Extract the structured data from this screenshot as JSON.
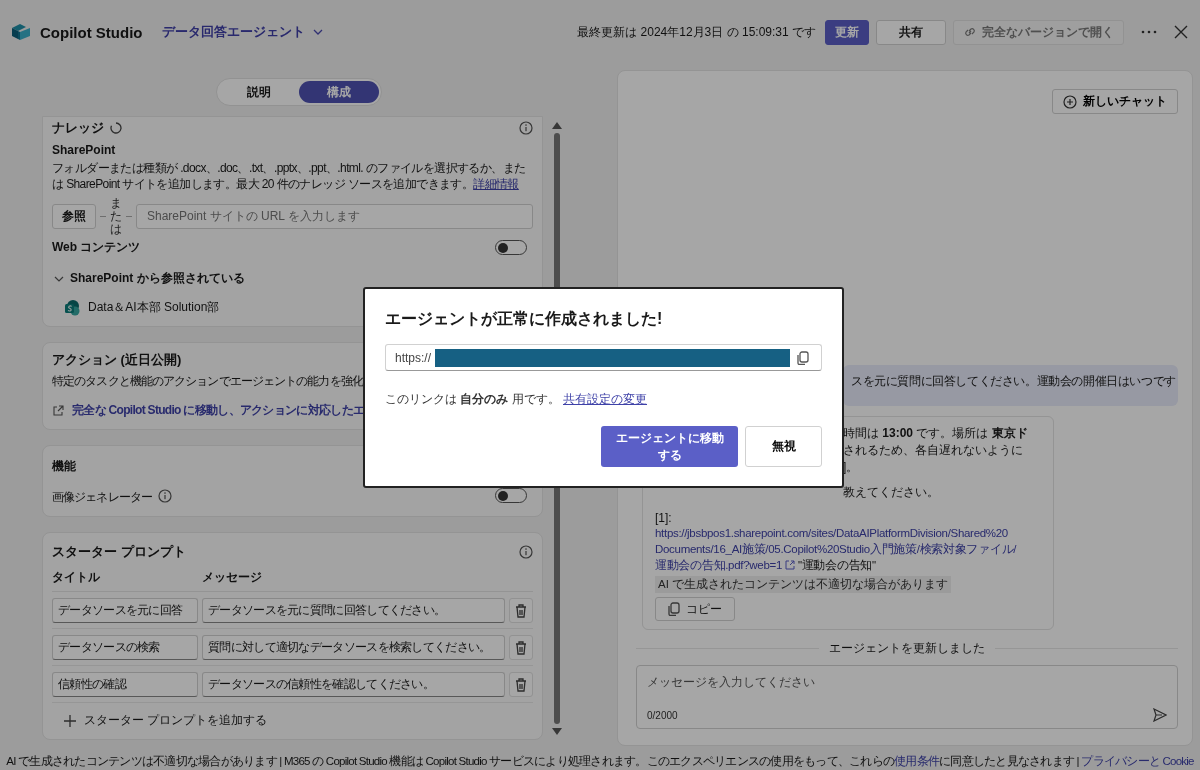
{
  "header": {
    "app_name": "Copilot Studio",
    "agent_name": "データ回答エージェント",
    "last_updated": "最終更新は 2024年12月3日 の 15:09:31 です",
    "buttons": [
      {
        "label": "更新",
        "kind": "primary",
        "disabled": false
      },
      {
        "label": "共有",
        "kind": "secondary",
        "disabled": false
      },
      {
        "label": "完全なバージョンで開く",
        "kind": "secondary",
        "disabled": true
      }
    ]
  },
  "tabs": [
    {
      "label": "説明",
      "selected": false
    },
    {
      "label": "構成",
      "selected": true
    }
  ],
  "knowledge": {
    "title": "ナレッジ",
    "source_label": "SharePoint",
    "description": "フォルダーまたは種類が .docx、.doc、.txt、.pptx、.ppt、.html. のファイルを選択するか、または SharePoint サイトを追加します。最大 20 件のナレッジ ソースを追加できます。",
    "more_link": "詳細情報",
    "browse_button": "参照",
    "or_text": "または",
    "url_placeholder": "SharePoint サイトの URL を入力します",
    "web_content": {
      "label": "Web コンテンツ",
      "on": false
    },
    "referenced": {
      "label": "SharePoint から参照されている",
      "expanded": true,
      "items": [
        "Data＆AI本部 Solution部"
      ]
    }
  },
  "action": {
    "title": "アクション (近日公開)",
    "description": "特定のタスクと機能のアクションでエージェントの能力を強化",
    "link": "完全な Copilot Studio に移動し、アクションに対応したエ"
  },
  "features": {
    "title": "機能",
    "items": [
      {
        "label": "画像ジェネレーター",
        "on": false
      }
    ]
  },
  "starter_prompts": {
    "title": "スターター プロンプト",
    "columns": [
      "タイトル",
      "メッセージ"
    ],
    "rows": [
      {
        "title": "データソースを元に回答",
        "message": "データソースを元に質問に回答してください。"
      },
      {
        "title": "データソースの検索",
        "message": "質問に対して適切なデータソースを検索してください。"
      },
      {
        "title": "信頼性の確認",
        "message": "データソースの信頼性を確認してください。"
      }
    ],
    "add_button": "スターター プロンプトを追加する"
  },
  "chat": {
    "new_chat_button": "新しいチャット",
    "user_message": "スを元に質問に回答してください。運動会の開催日はいつです",
    "bot_lines": [
      "時間は **13:00** です。場所は **東京ド**",
      "されるため、各自遅れないように",
      "]。",
      "教えてください。"
    ],
    "citation_label": "[1]:",
    "citation_url_lines": [
      "https://jbsbpos1.sharepoint.com/sites/DataAIPlatformDivision/Shared%20",
      "Documents/16_AI施策/05.Copilot%20Studio入門施策/検索対象ファイル/",
      "運動会の告知.pdf?web=1"
    ],
    "citation_title": "\"運動会の告知\"",
    "ai_notice": "AI で生成されたコンテンツは不適切な場合があります",
    "copy_button": "コピー",
    "divider_text": "エージェントを更新しました",
    "input_placeholder": "メッセージを入力してください",
    "char_count": "0/2000"
  },
  "footer": {
    "notice": "AI で生成されたコンテンツは不適切な場合があります | M365 の Copilot Studio 機能は Copilot Studio サービスにより処理されます。このエクスペリエンスの使用をもって、これらの",
    "terms_link": "使用条件",
    "notice_end": "に同意したと見なされます |",
    "privacy_link": "プライバシーと Cookie"
  },
  "dialog": {
    "title": "エージェントが正常に作成されました!",
    "url_prefix": "https://",
    "share_note": "このリンクは **自分のみ** 用です。",
    "share_link": "共有設定の変更",
    "primary_button": "エージェントに移動する",
    "dismiss_button": "無視"
  }
}
